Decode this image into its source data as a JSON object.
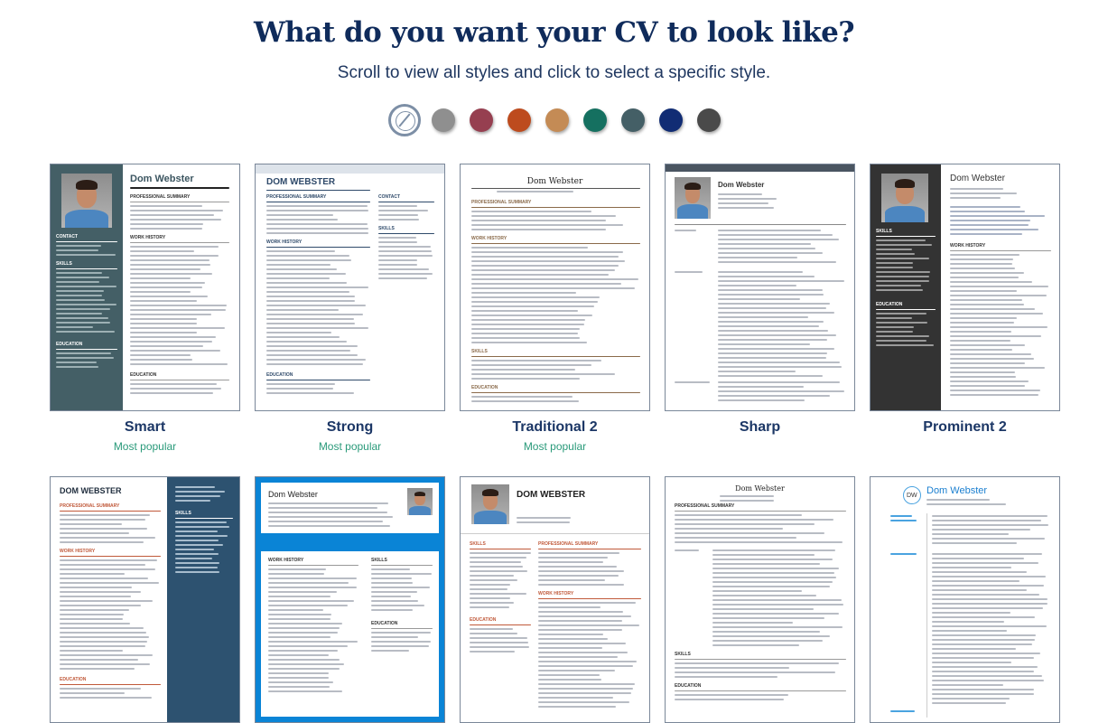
{
  "header": {
    "title": "What do you want your CV to look like?",
    "subtitle": "Scroll to view all styles and click to select a specific style."
  },
  "colors": [
    {
      "name": "no-color",
      "hex": "#ffffff"
    },
    {
      "name": "grey",
      "hex": "#8f8f8f"
    },
    {
      "name": "wine",
      "hex": "#963f50"
    },
    {
      "name": "rust",
      "hex": "#bd4b1e"
    },
    {
      "name": "tan",
      "hex": "#c48b55"
    },
    {
      "name": "green",
      "hex": "#157060"
    },
    {
      "name": "slate",
      "hex": "#445f66"
    },
    {
      "name": "navy",
      "hex": "#112c74"
    },
    {
      "name": "charcoal",
      "hex": "#4a4a4a"
    }
  ],
  "cv": {
    "name": "Dom Webster",
    "name_caps": "DOM WEBSTER",
    "summary": "PROFESSIONAL SUMMARY",
    "work": "WORK HISTORY",
    "skills": "SKILLS",
    "education": "EDUCATION",
    "contact": "CONTACT",
    "monogram": "DW"
  },
  "templates": [
    {
      "name": "Smart",
      "badge": "Most popular"
    },
    {
      "name": "Strong",
      "badge": "Most popular"
    },
    {
      "name": "Traditional 2",
      "badge": "Most popular"
    },
    {
      "name": "Sharp",
      "badge": ""
    },
    {
      "name": "Prominent 2",
      "badge": ""
    },
    {
      "name": "",
      "badge": ""
    },
    {
      "name": "",
      "badge": ""
    },
    {
      "name": "",
      "badge": ""
    },
    {
      "name": "",
      "badge": ""
    },
    {
      "name": "",
      "badge": ""
    }
  ]
}
